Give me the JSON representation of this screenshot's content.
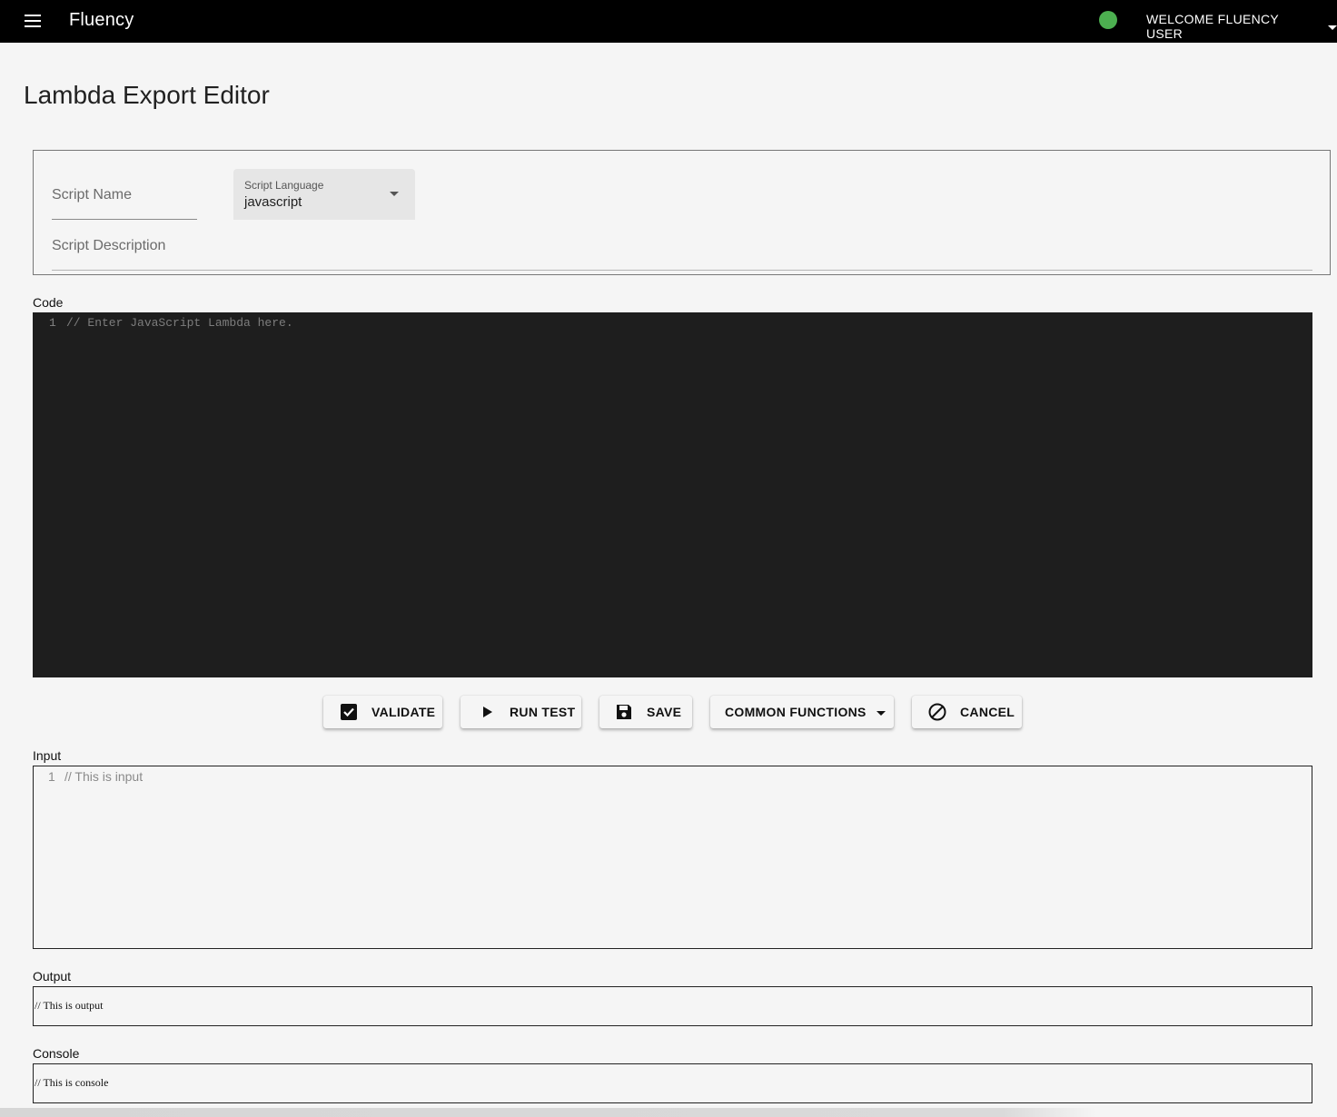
{
  "appbar": {
    "title": "Fluency",
    "user_label": "WELCOME FLUENCY USER",
    "status_color": "#4caf50"
  },
  "page": {
    "title": "Lambda Export Editor"
  },
  "form": {
    "script_name_placeholder": "Script Name",
    "language_label": "Script Language",
    "language_value": "javascript",
    "description_placeholder": "Script Description"
  },
  "code": {
    "label": "Code",
    "line_number": "1",
    "placeholder": "// Enter JavaScript Lambda here."
  },
  "actions": {
    "validate": "VALIDATE",
    "run_test": "RUN TEST",
    "save": "SAVE",
    "common_functions": "COMMON FUNCTIONS",
    "cancel": "CANCEL"
  },
  "input": {
    "label": "Input",
    "line_number": "1",
    "text": "// This is input"
  },
  "output": {
    "label": "Output",
    "text": "// This is output"
  },
  "console": {
    "label": "Console",
    "text": "// This is console"
  },
  "icons": {
    "menu": "menu-icon",
    "validate": "check-box-icon",
    "run": "play-icon",
    "save": "floppy-disk-icon",
    "cancel": "block-icon"
  }
}
